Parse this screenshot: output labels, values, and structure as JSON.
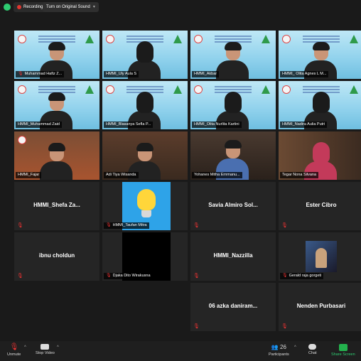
{
  "topbar": {
    "recording_label": "Recording",
    "sound_label": "Turn on Original Sound"
  },
  "tiles": [
    {
      "name": "Muhammad Hafiz Z...",
      "muted": true
    },
    {
      "name": "HMMI_Uly Aula S",
      "muted": false
    },
    {
      "name": "HMMI_Akbar",
      "muted": false
    },
    {
      "name": "HMMI_ Olita Agnes L M...",
      "muted": false
    },
    {
      "name": "HMMI_Muhammad Zaid",
      "muted": false
    },
    {
      "name": "HMMI_Blasanya Sefla P...",
      "muted": false
    },
    {
      "name": "HMMI_Olita Nurlita Kartini",
      "muted": false
    },
    {
      "name": "HMMI_Nadira Aulia Putri",
      "muted": false
    },
    {
      "name": "HMMI_Fajar",
      "muted": false
    },
    {
      "name": "Adi Tiya Wisanda",
      "muted": false
    },
    {
      "name": "Yohanes Mitha Ernmanu...",
      "muted": false
    },
    {
      "name": "Tegar Nona Silvana",
      "muted": false
    },
    {
      "name": "HMMI_Shefa Za...",
      "muted": true
    },
    {
      "name": "HMMI_Taufan Mitra",
      "muted": true
    },
    {
      "name": "Savia Almiro Sol...",
      "muted": true
    },
    {
      "name": "Ester Cibro",
      "muted": true
    },
    {
      "name": "ibnu choldun",
      "muted": true
    },
    {
      "name": "Djaka Dito Wirakusna",
      "muted": true
    },
    {
      "name": "HMMI_Nazzilla",
      "muted": true
    },
    {
      "name": "Gerald raja gorgeti",
      "muted": true
    },
    {
      "name": "06 azka daniram...",
      "muted": true
    },
    {
      "name": "Nenden Purbasari",
      "muted": true
    }
  ],
  "toolbar": {
    "unmute": "Unmute",
    "stop_video": "Stop Video",
    "participants": "Participants",
    "participants_count": "26",
    "chat": "Chat",
    "share_screen": "Share Screen"
  }
}
